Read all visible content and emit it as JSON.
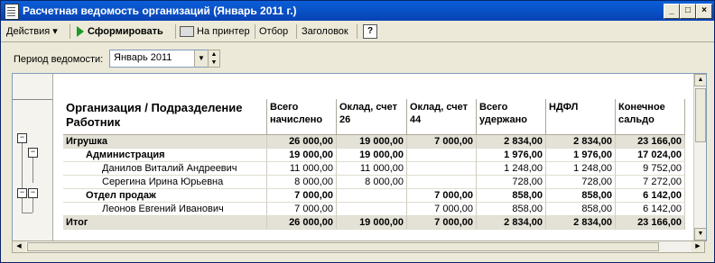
{
  "window": {
    "title": "Расчетная ведомость организаций (Январь 2011 г.)",
    "controls": {
      "minimize": "_",
      "maximize": "□",
      "close": "×"
    }
  },
  "toolbar": {
    "actions_label": "Действия ▾",
    "generate_label": "Сформировать",
    "print_label": "На принтер",
    "filter_label": "Отбор",
    "header_label": "Заголовок",
    "help_label": "?"
  },
  "period": {
    "label": "Период ведомости:",
    "value": "Январь 2011"
  },
  "table": {
    "columns": {
      "org_line1": "Организация / Подразделение",
      "org_line2": "Работник",
      "accrued": "Всего начислено",
      "salary26": "Оклад, счет 26",
      "salary44": "Оклад, счет 44",
      "withheld": "Всего удержано",
      "ndfl": "НДФЛ",
      "balance": "Конечное сальдо"
    },
    "rows": [
      {
        "name": "Игрушка",
        "accrued": "26 000,00",
        "salary26": "19 000,00",
        "salary44": "7 000,00",
        "withheld": "2 834,00",
        "ndfl": "2 834,00",
        "balance": "23 166,00"
      },
      {
        "name": "Администрация",
        "accrued": "19 000,00",
        "salary26": "19 000,00",
        "salary44": "",
        "withheld": "1 976,00",
        "ndfl": "1 976,00",
        "balance": "17 024,00"
      },
      {
        "name": "Данилов Виталий Андреевич",
        "accrued": "11 000,00",
        "salary26": "11 000,00",
        "salary44": "",
        "withheld": "1 248,00",
        "ndfl": "1 248,00",
        "balance": "9 752,00"
      },
      {
        "name": "Серегина Ирина Юрьевна",
        "accrued": "8 000,00",
        "salary26": "8 000,00",
        "salary44": "",
        "withheld": "728,00",
        "ndfl": "728,00",
        "balance": "7 272,00"
      },
      {
        "name": "Отдел продаж",
        "accrued": "7 000,00",
        "salary26": "",
        "salary44": "7 000,00",
        "withheld": "858,00",
        "ndfl": "858,00",
        "balance": "6 142,00"
      },
      {
        "name": "Леонов Евгений Иванович",
        "accrued": "7 000,00",
        "salary26": "",
        "salary44": "7 000,00",
        "withheld": "858,00",
        "ndfl": "858,00",
        "balance": "6 142,00"
      },
      {
        "name": "Итог",
        "accrued": "26 000,00",
        "salary26": "19 000,00",
        "salary44": "7 000,00",
        "withheld": "2 834,00",
        "ndfl": "2 834,00",
        "balance": "23 166,00"
      }
    ]
  },
  "icons": [
    "window-icon",
    "dropdown-arrow-icon",
    "play-icon",
    "printer-icon",
    "help-icon",
    "tree-collapse-icon",
    "scroll-up-icon",
    "scroll-down-icon",
    "scroll-left-icon",
    "scroll-right-icon"
  ],
  "colors": {
    "titlebar": "#0a5fd8",
    "accent_green": "#1c9a2a",
    "total_row": "#e4e1d7"
  }
}
